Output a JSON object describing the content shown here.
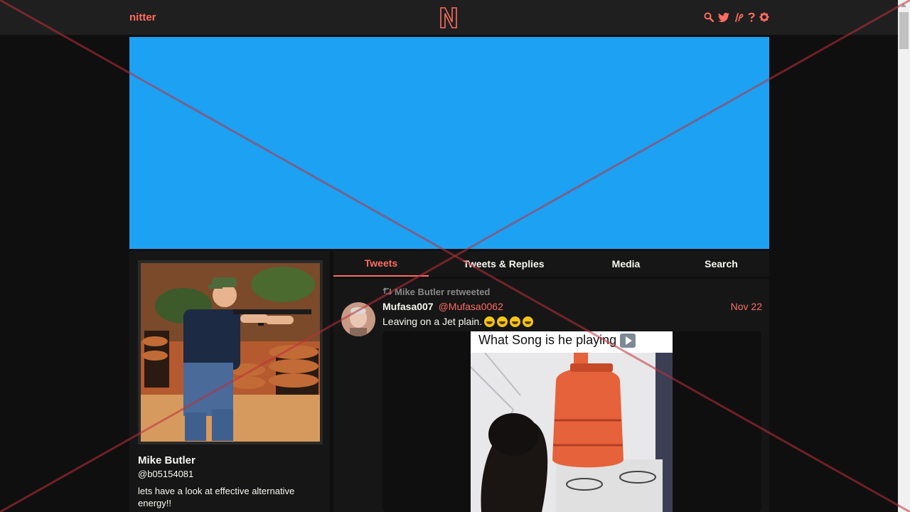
{
  "nav": {
    "brand": "nitter",
    "icons": [
      "search-icon",
      "twitter-bird-icon",
      "rss-icon",
      "help-icon",
      "gear-icon"
    ]
  },
  "profile": {
    "fullname": "Mike Butler",
    "username": "@b05154081",
    "bio": "lets have a look at effective alternative energy!!"
  },
  "tabs": [
    {
      "label": "Tweets",
      "active": true
    },
    {
      "label": "Tweets & Replies",
      "active": false
    },
    {
      "label": "Media",
      "active": false
    },
    {
      "label": "Search",
      "active": false
    }
  ],
  "tweet": {
    "retweet_header": "Mike Butler retweeted",
    "fullname": "Mufasa007",
    "username": "@Mufasa0062",
    "date": "Nov 22",
    "text": "Leaving on a Jet plain.",
    "emoji_count": 4,
    "media_caption": "What Song is he playing"
  },
  "colors": {
    "accent": "#ff6c60",
    "background": "#0f0f0f",
    "panel": "#161616",
    "banner": "#1da1f2"
  }
}
